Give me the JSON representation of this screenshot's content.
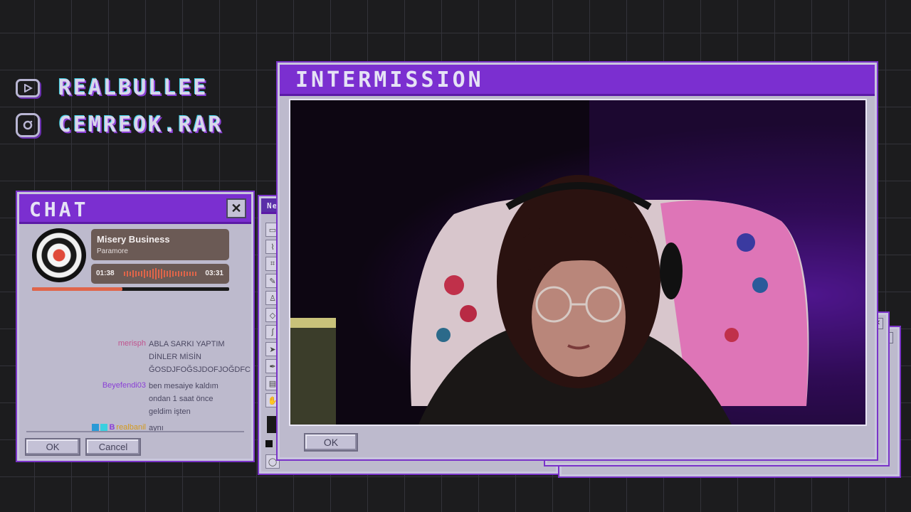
{
  "socials": [
    {
      "icon": "youtube-icon",
      "handle": "REALBULLEE"
    },
    {
      "icon": "instagram-icon",
      "handle": "CEMREOK.RAR"
    }
  ],
  "chat_window": {
    "title": "CHAT",
    "close_glyph": "✕",
    "ok_label": "OK",
    "cancel_label": "Cancel"
  },
  "now_playing": {
    "song": "Misery Business",
    "artist": "Paramore",
    "elapsed": "01:38",
    "total": "03:31",
    "progress": 0.46
  },
  "chat_messages": [
    {
      "user": "merisph",
      "user_color": "#c0548e",
      "lines": [
        "ABLA SARKI YAPTIM",
        "DİNLER MİSİN",
        "ĞOSDJFOĞSJDOFJOĞDFC"
      ]
    },
    {
      "user": "Beyefendi03",
      "user_color": "#8a3fd6",
      "lines": [
        "ben mesaiye kaldım",
        "ondan 1 saat önce",
        "geldim işten"
      ]
    },
    {
      "user": "realbanil",
      "user_color": "#d49a1c",
      "badge": "B",
      "lines": [
        "aynı"
      ]
    }
  ],
  "editor_window": {
    "title_fragment": "Ne"
  },
  "intermission_window": {
    "title": "INTERMISSION",
    "ok_label": "OK"
  },
  "colors": {
    "accent_purple": "#7b2fd0",
    "window_gray": "#bdbacd",
    "background": "#1c1c1e"
  }
}
